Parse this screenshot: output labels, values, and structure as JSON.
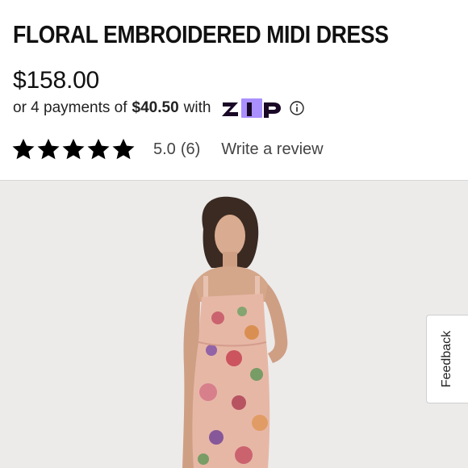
{
  "product": {
    "title": "FLORAL EMBROIDERED MIDI DRESS",
    "price": "$158.00"
  },
  "payments": {
    "prefix": "or 4 payments of",
    "amount": "$40.50",
    "connector": "with",
    "provider_logo": "zip",
    "info_icon": "info-circle-icon",
    "logo_color": "#1a0826",
    "logo_accent": "#aa8fff"
  },
  "rating": {
    "stars": 5,
    "score": "5.0",
    "count": "(6)",
    "review_link": "Write a review"
  },
  "image": {
    "alt_icon": "product-photo",
    "background": "#ecebea"
  },
  "feedback": {
    "label": "Feedback"
  }
}
